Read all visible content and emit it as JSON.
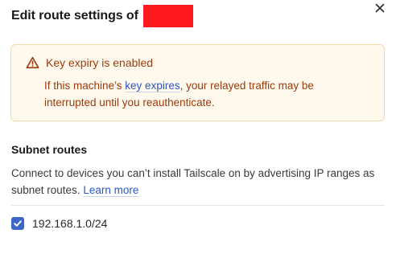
{
  "dialog": {
    "title": "Edit route settings of",
    "close_icon": "close-icon"
  },
  "warning": {
    "icon": "warning-icon",
    "title": "Key expiry is enabled",
    "body_before": "If this machine’s ",
    "link": "key expires",
    "body_after": ", your relayed traffic may be interrupted until you reauthenticate.",
    "colors": {
      "background": "#fff8ec",
      "border": "#f5d9a8",
      "text": "#9a3b0c"
    }
  },
  "subnet_routes": {
    "title": "Subnet routes",
    "description": "Connect to devices you can’t install Tailscale on by advertising IP ranges as subnet routes.",
    "learn_more": "Learn more",
    "routes": [
      {
        "label": "192.168.1.0/24",
        "checked": true
      }
    ]
  },
  "colors": {
    "accent": "#3e66c7",
    "link": "#2b59c3",
    "redaction": "#ff1a22"
  }
}
